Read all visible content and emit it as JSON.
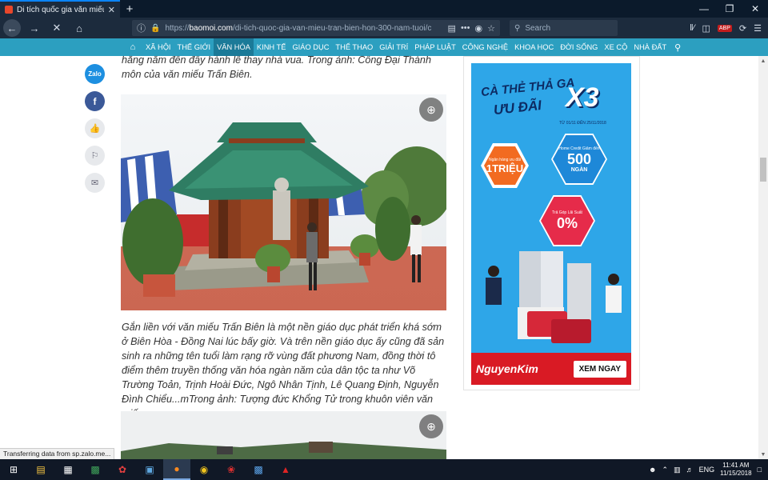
{
  "browser": {
    "tab_title": "Di tích quốc gia văn miếu Trấn",
    "tab_close": "✕",
    "new_tab": "+",
    "url_prefix": "https://",
    "url_domain": "baomoi.com",
    "url_path": "/di-tich-quoc-gia-van-mieu-tran-bien-hon-300-nam-tuoi/c",
    "search_placeholder": "Search",
    "abp_label": "ABP"
  },
  "site_nav": {
    "items": [
      "XÃ HỘI",
      "THẾ GIỚI",
      "VĂN HÓA",
      "KINH TẾ",
      "GIÁO DỤC",
      "THỂ THAO",
      "GIẢI TRÍ",
      "PHÁP LUẬT",
      "CÔNG NGHỆ",
      "KHOA HỌC",
      "ĐỜI SỐNG",
      "XE CỘ",
      "NHÀ ĐẤT"
    ],
    "active": "VĂN HÓA"
  },
  "social": {
    "zalo": "Zalo",
    "facebook": "f"
  },
  "article": {
    "caption_top": "hằng năm đến đây hành lễ thay nhà vua. Trong ảnh: Cổng Đại Thành môn của văn miếu Trấn Biên.",
    "caption_main": "Gắn liền với văn miếu Trấn Biên là một nền giáo dục phát triển khá sớm ở Biên Hòa - Đồng Nai lúc bấy giờ. Và trên nền giáo dục ấy cũng đã sản sinh ra những tên tuổi làm rạng rỡ vùng đất phương Nam, đồng thời tô điểm thêm truyền thống văn hóa ngàn năm của dân tộc ta như Võ Trường Toản, Trịnh Hoài Đức, Ngô Nhân Tịnh, Lê Quang Định, Nguyễn Đình Chiểu...mTrong ảnh: Tượng đức Khổng Tử trong khuôn viên văn miếu."
  },
  "ad": {
    "headline_1": "CÀ THẺ THẢ GA",
    "headline_2": "ƯU ĐÃI",
    "multiplier": "X3",
    "date_note": "TỪ 01/11 ĐẾN 25/11/2018",
    "offer_1_small": "Ngân hàng ưu đãi",
    "offer_1_big": "1TRIỆU",
    "offer_2_small": "Home Credit Giảm đến",
    "offer_2_big": "500",
    "offer_2_unit": "NGÀN",
    "offer_3_small": "Trả Góp Lãi Suất",
    "offer_3_big": "0%",
    "brand": "NguyenKim",
    "cta": "XEM NGAY"
  },
  "status_bar": "Transferring data from sp.zalo.me...",
  "taskbar": {
    "lang": "ENG",
    "time": "11:41 AM",
    "date": "11/15/2018"
  },
  "colors": {
    "site_nav_bg": "#2c9fc0",
    "site_nav_active": "#1b7a98",
    "browser_chrome": "#1c2b3d",
    "ad_bg": "#2ea6e8",
    "ad_brand_bg": "#d91a24"
  }
}
